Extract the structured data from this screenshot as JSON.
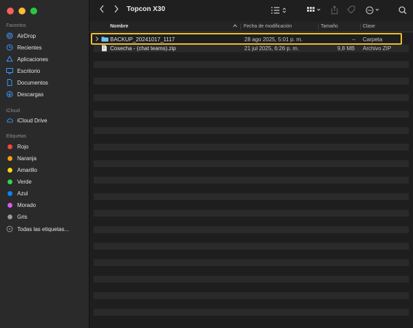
{
  "window": {
    "title": "Topcon X30",
    "traffic_colors": [
      "#ff5f57",
      "#febc2e",
      "#28c840"
    ]
  },
  "sidebar": {
    "favorites_title": "Favoritos",
    "favorites": [
      {
        "label": "AirDrop",
        "icon": "airdrop-icon"
      },
      {
        "label": "Recientes",
        "icon": "clock-icon"
      },
      {
        "label": "Aplicaciones",
        "icon": "applications-icon"
      },
      {
        "label": "Escritorio",
        "icon": "desktop-icon"
      },
      {
        "label": "Documentos",
        "icon": "document-icon"
      },
      {
        "label": "Descargas",
        "icon": "download-icon"
      }
    ],
    "icloud_title": "iCloud",
    "icloud": [
      {
        "label": "iCloud Drive",
        "icon": "cloud-icon"
      }
    ],
    "tags_title": "Etiquetas",
    "tags": [
      {
        "label": "Rojo",
        "color": "#ff453a"
      },
      {
        "label": "Naranja",
        "color": "#ff9f0a"
      },
      {
        "label": "Amarillo",
        "color": "#ffd60a"
      },
      {
        "label": "Verde",
        "color": "#32d74b"
      },
      {
        "label": "Azul",
        "color": "#0a84ff"
      },
      {
        "label": "Morado",
        "color": "#da5cf2"
      },
      {
        "label": "Gris",
        "color": "#98989d"
      }
    ],
    "all_tags_label": "Todas las etiquetas..."
  },
  "columns": {
    "name": "Nombre",
    "date": "Fecha de modificación",
    "size": "Tamaño",
    "kind": "Clase"
  },
  "files": [
    {
      "name": "BACKUP_20241017_1117",
      "date": "28 ago 2025, 5:01 p. m.",
      "size": "--",
      "kind": "Carpeta",
      "type": "folder"
    },
    {
      "name": "Cosecha - (chat teams).zip",
      "date": "21 jul 2025, 6:26 p. m.",
      "size": "9,8 MB",
      "kind": "Archivo ZIP",
      "type": "zip"
    }
  ]
}
